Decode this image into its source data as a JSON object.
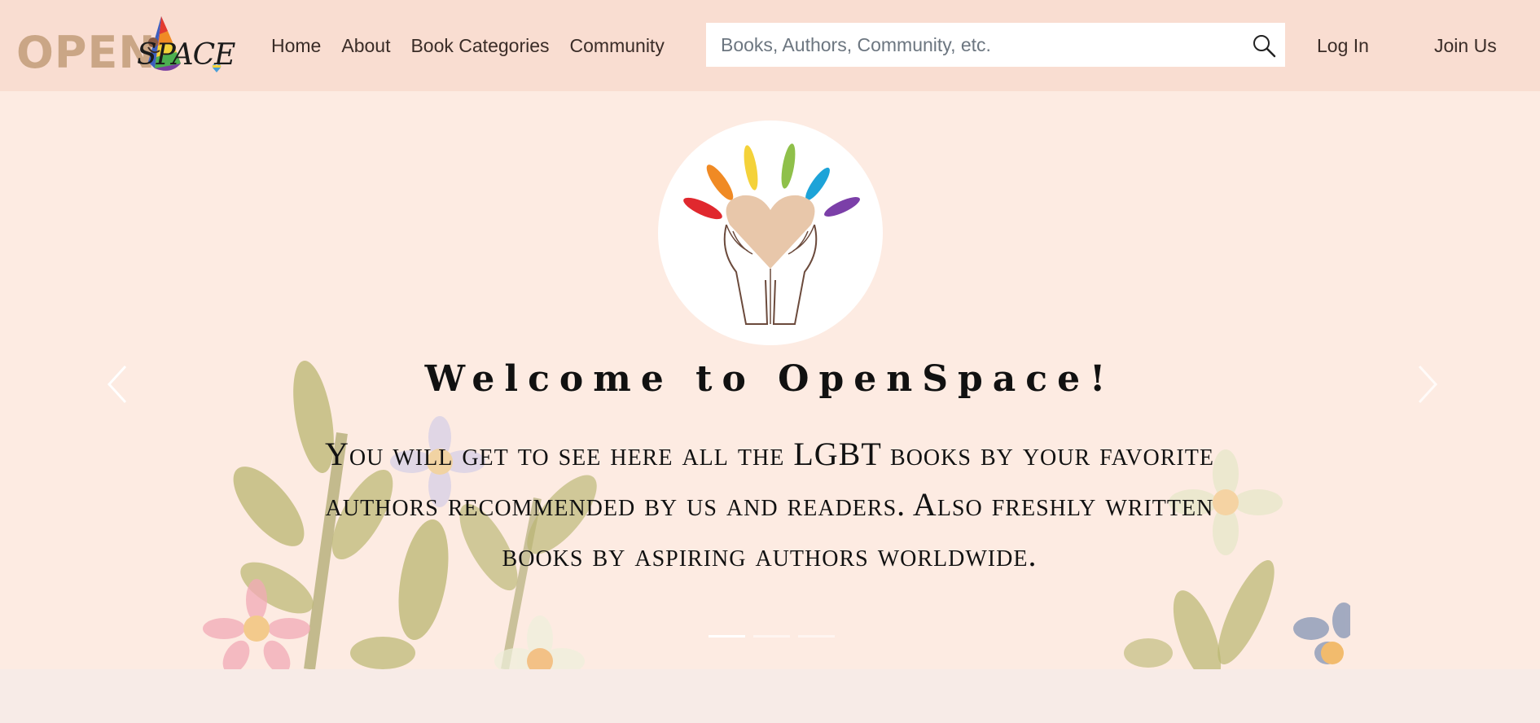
{
  "brand": {
    "logo_open": "OPEN",
    "logo_space": "SPACE",
    "logo_alt": "OpenSpace logo"
  },
  "nav": {
    "items": [
      {
        "label": "Home"
      },
      {
        "label": "About"
      },
      {
        "label": "Book Categories"
      },
      {
        "label": "Community"
      }
    ]
  },
  "search": {
    "placeholder": "Books, Authors, Community, etc.",
    "value": "",
    "icon": "search-icon"
  },
  "auth": {
    "login_label": "Log In",
    "join_label": "Join Us"
  },
  "hero": {
    "title": "Welcome to OpenSpace!",
    "body": "You will get to see here all the LGBT books by your favorite authors recommended by us and readers. Also freshly written books by aspiring authors worldwide.",
    "slide_count": 3,
    "active_slide": 1,
    "prev_icon": "chevron-left-icon",
    "next_icon": "chevron-right-icon"
  },
  "colors": {
    "navbar_bg": "#f9ddd1",
    "hero_bg": "#fdebe2",
    "logo_tan": "#caa686",
    "text_dark": "#3a2c27"
  }
}
